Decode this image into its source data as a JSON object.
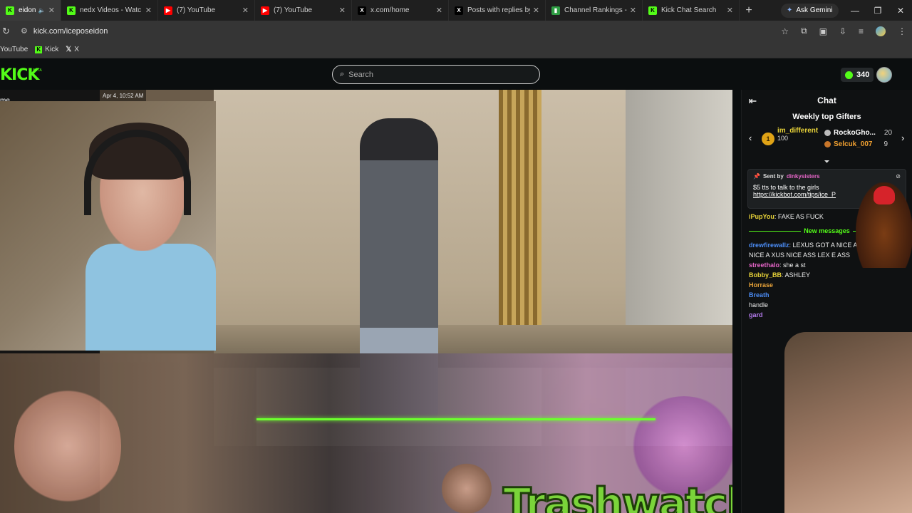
{
  "browser": {
    "tabs": [
      {
        "title": "eidon Stream",
        "icon": "kick",
        "active": true
      },
      {
        "title": "nedx Videos - Watc",
        "icon": "kick",
        "active": false
      },
      {
        "title": "(7) YouTube",
        "icon": "youtube",
        "active": false
      },
      {
        "title": "(7) YouTube",
        "icon": "youtube",
        "active": false
      },
      {
        "title": "x.com/home",
        "icon": "x",
        "active": false
      },
      {
        "title": "Posts with replies by Th",
        "icon": "x",
        "active": false
      },
      {
        "title": "Channel Rankings - Kic",
        "icon": "chart",
        "active": false
      },
      {
        "title": "Kick Chat Search",
        "icon": "kick",
        "active": false
      }
    ],
    "new_tab": "+",
    "ask_gemini": "Ask Gemini",
    "url": "kick.com/iceposeidon",
    "bookmarks": [
      {
        "label": "YouTube",
        "icon": "none"
      },
      {
        "label": "Kick",
        "icon": "kick"
      },
      {
        "label": "X",
        "icon": "x"
      }
    ]
  },
  "kick": {
    "logo": "KICK",
    "beta": "BETA",
    "search_placeholder": "Search",
    "points": "340",
    "home_label": "me",
    "timestamp": "Apr 4, 10:52 AM",
    "overlay_text": "Trashwatch"
  },
  "chat": {
    "title": "Chat",
    "gifters_title": "Weekly top Gifters",
    "top_gifter": {
      "rank": "1",
      "name": "im_different",
      "count": "100"
    },
    "gifters": [
      {
        "name": "RockoGho...",
        "count": "20",
        "color": "#ffffff"
      },
      {
        "name": "Selcuk_007",
        "count": "9",
        "color": "#f0a030"
      }
    ],
    "pinned": {
      "sent_by_label": "Sent by",
      "sender": "dinkysisters",
      "message": "$5 tts to talk to the girls",
      "link": "https://kickbot.com/tips/ice_P"
    },
    "messages_before": [
      {
        "user": "iPupYou",
        "text": ": FAKE AS FUCK",
        "color": "#e8d339"
      }
    ],
    "new_messages_label": "New messages",
    "messages_after": [
      {
        "user": "drewfirewallz",
        "text": ": LEXUS GOT A NICE A LEXUS GOT A NICE A   XUS NICE ASS   LEX   E ASS",
        "color": "#4b8cf5"
      },
      {
        "user": "streethalo",
        "text": ": she a st",
        "color": "#e565c7"
      },
      {
        "user": "Bobby_BB",
        "text": ": ASHLEY",
        "color": "#e8d339"
      },
      {
        "user": "Horrase",
        "text": "",
        "color": "#e8a339"
      },
      {
        "user": "Breath",
        "text": "",
        "color": "#4b8cf5"
      },
      {
        "user": "",
        "text": "handle",
        "color": "#eeeeee"
      },
      {
        "user": "gard",
        "text": "",
        "color": "#b67cf0"
      }
    ]
  }
}
